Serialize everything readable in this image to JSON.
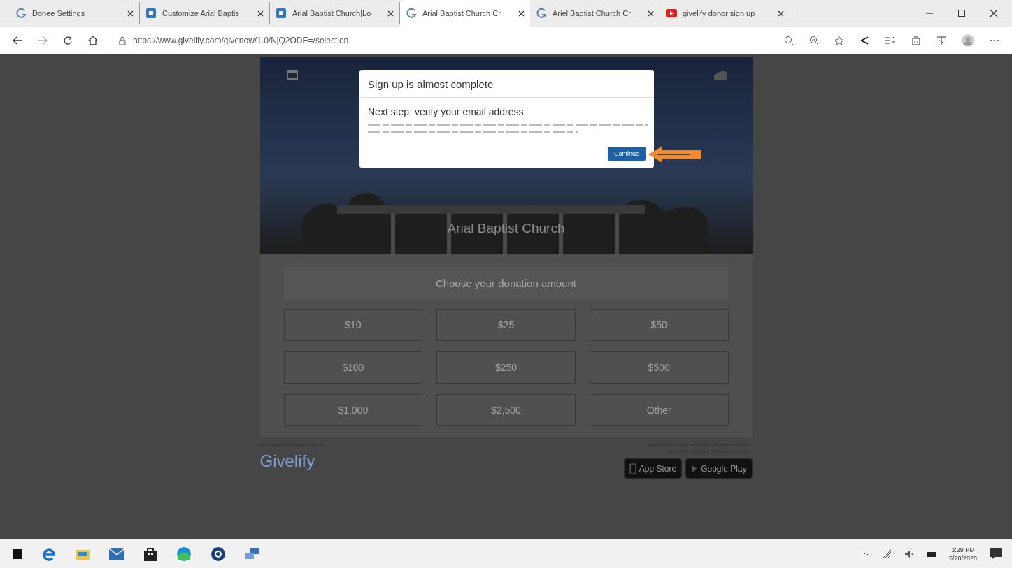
{
  "browser": {
    "tabs": [
      {
        "label": "Donee Settings",
        "kind": "givelify",
        "selected": false
      },
      {
        "label": "Customize Arial Baptis",
        "kind": "app",
        "selected": false
      },
      {
        "label": "Arial Baptist Church|Lo",
        "kind": "app",
        "selected": false
      },
      {
        "label": "Arial Baptist Church Cr",
        "kind": "givelify",
        "selected": true
      },
      {
        "label": "Ariel Baptist Church Cr",
        "kind": "givelify",
        "selected": false
      },
      {
        "label": "givelify donor sign up",
        "kind": "video",
        "selected": false
      }
    ],
    "url": "https://www.givelify.com/givenow/1.0/NjQ2ODE=/selection"
  },
  "page": {
    "hero": {
      "title": "Arial Baptist Church"
    },
    "donation": {
      "heading": "Choose your donation amount",
      "amounts": [
        "$10",
        "$25",
        "$50",
        "$100",
        "$250",
        "$500",
        "$1,000",
        "$2,500",
        "Other"
      ]
    },
    "footer": {
      "brand": "Givelify",
      "store_buttons": [
        {
          "kind": "apple",
          "label": "App Store"
        },
        {
          "kind": "google",
          "label": "Google Play"
        }
      ]
    }
  },
  "modal": {
    "title": "Sign up is almost complete",
    "subtitle": "Next step: verify your email address",
    "button": "Continue"
  },
  "taskbar": {
    "time": "3:29 PM",
    "date": "5/20/2020"
  }
}
